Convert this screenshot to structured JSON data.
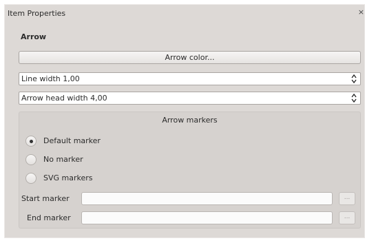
{
  "window": {
    "title": "Item Properties",
    "close_glyph": "×"
  },
  "section": {
    "title": "Arrow"
  },
  "arrow_color_button": {
    "label": "Arrow color..."
  },
  "line_width": {
    "label": "Line width 1,00"
  },
  "arrow_head_width": {
    "label": "Arrow head width 4,00"
  },
  "markers": {
    "title": "Arrow markers",
    "options": [
      {
        "label": "Default marker",
        "selected": true
      },
      {
        "label": "No marker",
        "selected": false
      },
      {
        "label": "SVG markers",
        "selected": false
      }
    ],
    "start_marker_label": "Start marker",
    "end_marker_label": "End marker",
    "browse_label": "..."
  }
}
